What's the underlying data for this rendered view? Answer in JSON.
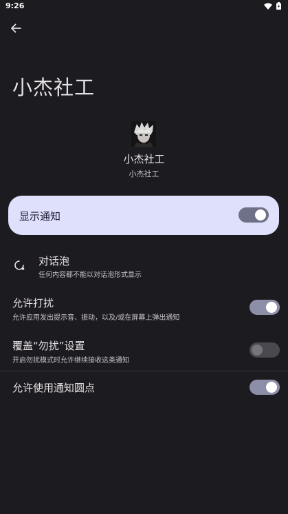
{
  "status_bar": {
    "time": "9:26"
  },
  "header": {
    "title": "小杰社工"
  },
  "app": {
    "name": "小杰社工",
    "subtitle": "小杰社工"
  },
  "master": {
    "label": "显示通知",
    "enabled": true
  },
  "bubbles": {
    "title": "对话泡",
    "subtitle": "任何内容都不能以对话泡形式显示"
  },
  "allow_interrupt": {
    "title": "允许打扰",
    "subtitle": "允许应用发出提示音、振动，以及/或在屏幕上弹出通知",
    "enabled": true
  },
  "dnd_override": {
    "title": "覆盖“勿扰”设置",
    "subtitle": "开启勿扰模式时允许继续接收这类通知",
    "enabled": false
  },
  "notification_dot": {
    "title": "允许使用通知圆点",
    "enabled": true
  },
  "icons": {
    "back": "arrow-back-icon",
    "wifi": "wifi-icon",
    "battery": "battery-icon",
    "bubble": "bubble-icon"
  },
  "colors": {
    "background": "#1c1b1f",
    "master_card": "#dfe0fb",
    "toggle_on_track": "#8d8fa8",
    "toggle_off_track": "#4a4950"
  }
}
